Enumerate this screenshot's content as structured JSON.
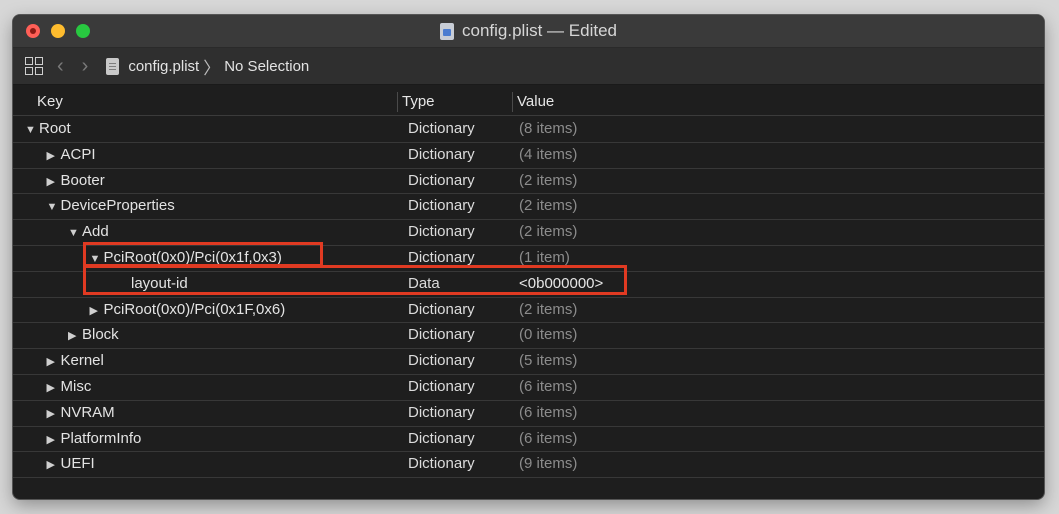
{
  "window": {
    "title": "config.plist — Edited"
  },
  "toolbar": {
    "file_name": "config.plist",
    "selection": "No Selection",
    "separator": "〉"
  },
  "columns": {
    "key": "Key",
    "type": "Type",
    "value": "Value"
  },
  "rows": [
    {
      "key": "Root",
      "type": "Dictionary",
      "value": "(8 items)",
      "disclosure": "expanded",
      "depth": 0
    },
    {
      "key": "ACPI",
      "type": "Dictionary",
      "value": "(4 items)",
      "disclosure": "collapsed",
      "depth": 1
    },
    {
      "key": "Booter",
      "type": "Dictionary",
      "value": "(2 items)",
      "disclosure": "collapsed",
      "depth": 1
    },
    {
      "key": "DeviceProperties",
      "type": "Dictionary",
      "value": "(2 items)",
      "disclosure": "expanded",
      "depth": 1
    },
    {
      "key": "Add",
      "type": "Dictionary",
      "value": "(2 items)",
      "disclosure": "expanded",
      "depth": 2
    },
    {
      "key": "PciRoot(0x0)/Pci(0x1f,0x3)",
      "type": "Dictionary",
      "value": "(1 item)",
      "disclosure": "expanded",
      "depth": 3
    },
    {
      "key": "layout-id",
      "type": "Data",
      "value": "<0b000000>",
      "disclosure": "none",
      "depth": 4
    },
    {
      "key": "PciRoot(0x0)/Pci(0x1F,0x6)",
      "type": "Dictionary",
      "value": "(2 items)",
      "disclosure": "collapsed",
      "depth": 3
    },
    {
      "key": "Block",
      "type": "Dictionary",
      "value": "(0 items)",
      "disclosure": "collapsed",
      "depth": 2
    },
    {
      "key": "Kernel",
      "type": "Dictionary",
      "value": "(5 items)",
      "disclosure": "collapsed",
      "depth": 1
    },
    {
      "key": "Misc",
      "type": "Dictionary",
      "value": "(6 items)",
      "disclosure": "collapsed",
      "depth": 1
    },
    {
      "key": "NVRAM",
      "type": "Dictionary",
      "value": "(6 items)",
      "disclosure": "collapsed",
      "depth": 1
    },
    {
      "key": "PlatformInfo",
      "type": "Dictionary",
      "value": "(6 items)",
      "disclosure": "collapsed",
      "depth": 1
    },
    {
      "key": "UEFI",
      "type": "Dictionary",
      "value": "(9 items)",
      "disclosure": "collapsed",
      "depth": 1
    }
  ],
  "colors": {
    "highlight": "#e03a22",
    "window_bg": "#1e1e1e"
  }
}
